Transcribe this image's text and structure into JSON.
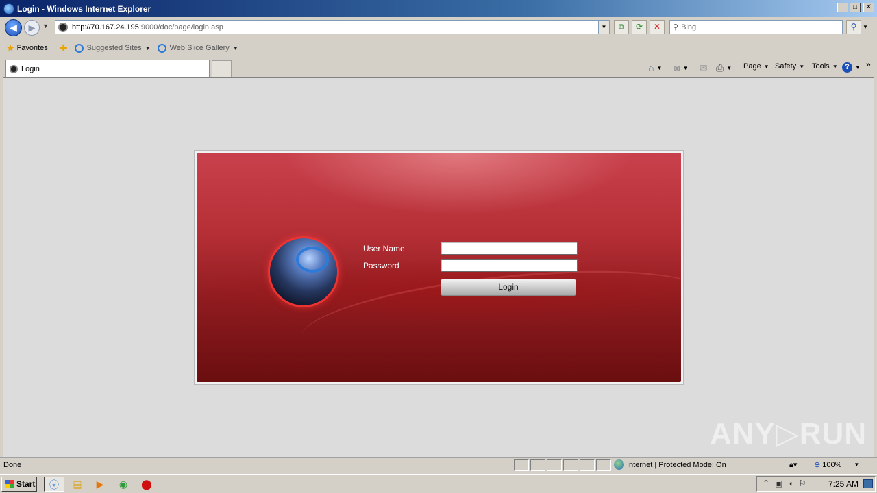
{
  "window": {
    "title": "Login - Windows Internet Explorer",
    "minimize": "_",
    "maximize": "□",
    "close": "✕"
  },
  "navbar": {
    "url_host": "http://70.167.24.195",
    "url_path": ":9000/doc/page/login.asp",
    "search_placeholder": "Bing"
  },
  "favorites": {
    "label": "Favorites",
    "links": [
      "Suggested Sites",
      "Web Slice Gallery"
    ]
  },
  "tabs": [
    {
      "label": "Login"
    }
  ],
  "command_bar": {
    "page": "Page",
    "safety": "Safety",
    "tools": "Tools"
  },
  "login": {
    "username_label": "User Name",
    "password_label": "Password",
    "username_value": "",
    "password_value": "",
    "button_label": "Login"
  },
  "watermark": "ANY▷RUN",
  "statusbar": {
    "status": "Done",
    "zone": "Internet | Protected Mode: On",
    "zoom": "100%"
  },
  "taskbar": {
    "start_label": "Start",
    "clock": "7:25 AM"
  },
  "colors": {
    "panel_top": "#c9414c",
    "panel_bottom": "#6a0e10",
    "titlebar": "#0a246a"
  }
}
